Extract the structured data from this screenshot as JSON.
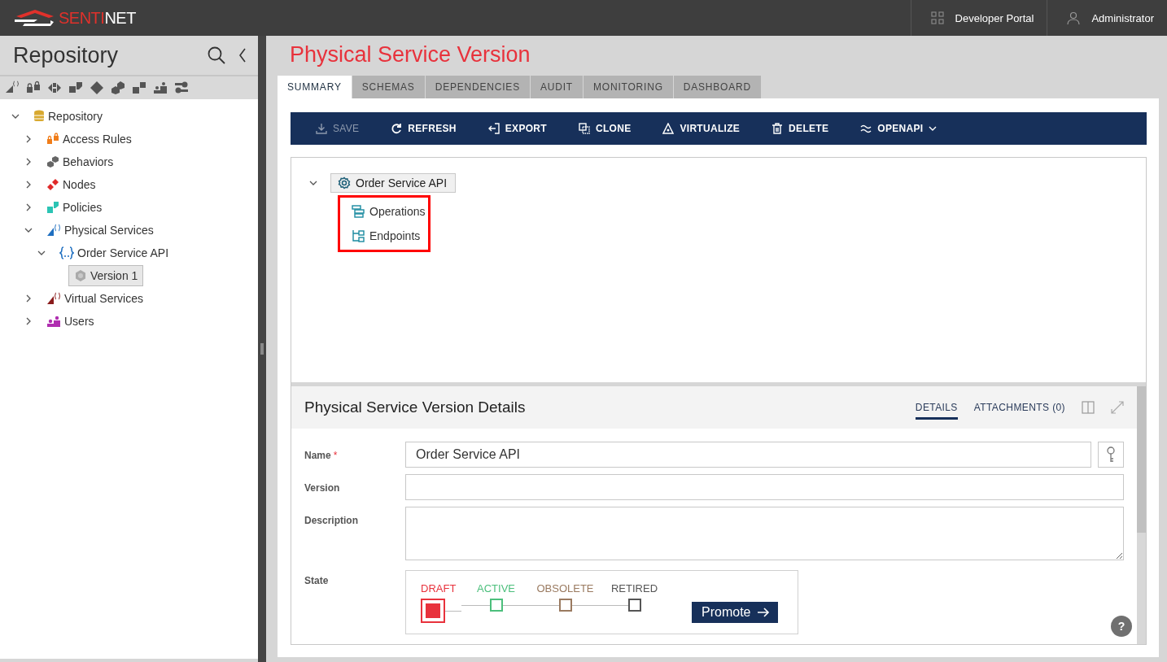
{
  "topbar": {
    "logo": {
      "part1": "SENTI",
      "part2": "NET"
    },
    "links": [
      {
        "label": "Developer Portal",
        "kind": "grid"
      },
      {
        "label": "Administrator",
        "kind": "user"
      }
    ]
  },
  "sidebar": {
    "title": "Repository",
    "tree": [
      {
        "label": "Repository",
        "kind": "database",
        "expanded": true,
        "selected": false,
        "children": [
          {
            "label": "Access Rules",
            "kind": "locks",
            "expanded": false,
            "selected": false
          },
          {
            "label": "Behaviors",
            "kind": "hexes",
            "expanded": false,
            "selected": false
          },
          {
            "label": "Nodes",
            "kind": "diamonds",
            "expanded": false,
            "selected": false
          },
          {
            "label": "Policies",
            "kind": "blocks",
            "expanded": false,
            "selected": false
          },
          {
            "label": "Physical Services",
            "kind": "physical",
            "expanded": true,
            "selected": false,
            "children": [
              {
                "label": "Order Service API",
                "kind": "braces",
                "expanded": true,
                "selected": false,
                "children": [
                  {
                    "label": "Version 1",
                    "kind": "gear",
                    "selected": true
                  }
                ]
              }
            ]
          },
          {
            "label": "Virtual Services",
            "kind": "virtual",
            "expanded": false,
            "selected": false
          },
          {
            "label": "Users",
            "kind": "users",
            "expanded": false,
            "selected": false
          }
        ]
      }
    ]
  },
  "main": {
    "title": "Physical Service Version",
    "tabs": [
      {
        "label": "SUMMARY",
        "selected": true
      },
      {
        "label": "SCHEMAS",
        "selected": false
      },
      {
        "label": "DEPENDENCIES",
        "selected": false
      },
      {
        "label": "AUDIT",
        "selected": false
      },
      {
        "label": "MONITORING",
        "selected": false
      },
      {
        "label": "DASHBOARD",
        "selected": false
      }
    ],
    "toolbar": [
      {
        "label": "SAVE",
        "kind": "save",
        "disabled": true,
        "dropdown": false
      },
      {
        "label": "REFRESH",
        "kind": "refresh",
        "disabled": false,
        "dropdown": false
      },
      {
        "label": "EXPORT",
        "kind": "export",
        "disabled": false,
        "dropdown": false
      },
      {
        "label": "CLONE",
        "kind": "clone",
        "disabled": false,
        "dropdown": false
      },
      {
        "label": "VIRTUALIZE",
        "kind": "virtualize",
        "disabled": false,
        "dropdown": false
      },
      {
        "label": "DELETE",
        "kind": "delete",
        "disabled": false,
        "dropdown": false
      },
      {
        "label": "OPENAPI",
        "kind": "openapi",
        "disabled": false,
        "dropdown": true
      }
    ],
    "service_tree": {
      "label": "Order Service API",
      "expanded": true,
      "children_highlighted": true,
      "children": [
        {
          "label": "Operations",
          "kind": "operations"
        },
        {
          "label": "Endpoints",
          "kind": "endpoints"
        }
      ]
    },
    "details": {
      "title": "Physical Service Version Details",
      "tabs": [
        {
          "label": "DETAILS",
          "selected": true
        },
        {
          "label": "ATTACHMENTS (0)",
          "selected": false
        }
      ],
      "fields": [
        {
          "label": "Name",
          "required_mark": "*",
          "kind": "text",
          "value": "Order Service API",
          "key_button": true
        },
        {
          "label": "Version",
          "kind": "text",
          "key_button": false
        },
        {
          "label": "Description",
          "kind": "textarea",
          "key_button": false
        }
      ],
      "state": {
        "label": "State",
        "steps": [
          {
            "label": "DRAFT",
            "color": "#e8323c",
            "selected": true
          },
          {
            "label": "ACTIVE",
            "color": "#4cbf7c",
            "selected": false
          },
          {
            "label": "OBSOLETE",
            "color": "#9a7a60",
            "selected": false
          },
          {
            "label": "RETIRED",
            "color": "#555555",
            "selected": false
          }
        ],
        "button": "Promote"
      },
      "help": "?"
    }
  }
}
